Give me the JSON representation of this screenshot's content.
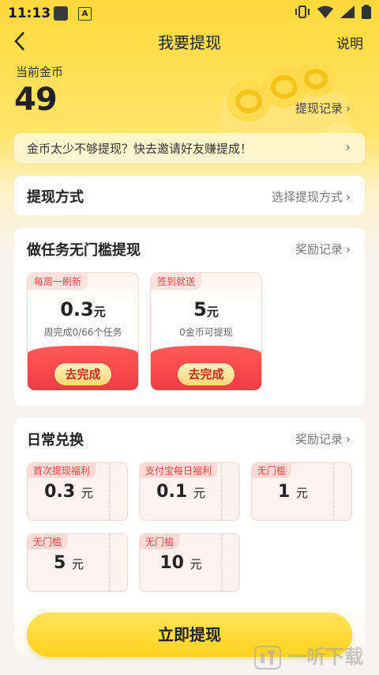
{
  "status_bar": {
    "time": "11:13",
    "notif_letter": "A"
  },
  "header": {
    "title": "我要提现",
    "help_label": "说明"
  },
  "coins": {
    "label": "当前金币",
    "value": "49",
    "record_link": "提现记录"
  },
  "invite_banner": {
    "text": "金币太少不够提现？快去邀请好友赚提成！"
  },
  "method": {
    "title": "提现方式",
    "link": "选择提现方式"
  },
  "task_section": {
    "title": "做任务无门槛提现",
    "link": "奖励记录",
    "cards": [
      {
        "tag": "每周一刷新",
        "amount": "0.3",
        "unit": "元",
        "desc": "周完成0/66个任务",
        "button": "去完成"
      },
      {
        "tag": "签到就送",
        "amount": "5",
        "unit": "元",
        "desc": "0金币可提现",
        "button": "去完成"
      }
    ]
  },
  "daily_section": {
    "title": "日常兑换",
    "link": "奖励记录",
    "vouchers": [
      {
        "tag": "首次提现福利",
        "amount": "0.3",
        "unit": "元"
      },
      {
        "tag": "支付宝每日福利",
        "amount": "0.1",
        "unit": "元"
      },
      {
        "tag": "无门槛",
        "amount": "1",
        "unit": "元"
      },
      {
        "tag": "无门槛",
        "amount": "5",
        "unit": "元"
      },
      {
        "tag": "无门槛",
        "amount": "10",
        "unit": "元"
      }
    ]
  },
  "submit_label": "立即提现",
  "watermark": "一听下载",
  "colors": {
    "brand_yellow": "#ffd93b",
    "accent_red": "#f23c45",
    "button_yellow": "#ffd21c"
  }
}
